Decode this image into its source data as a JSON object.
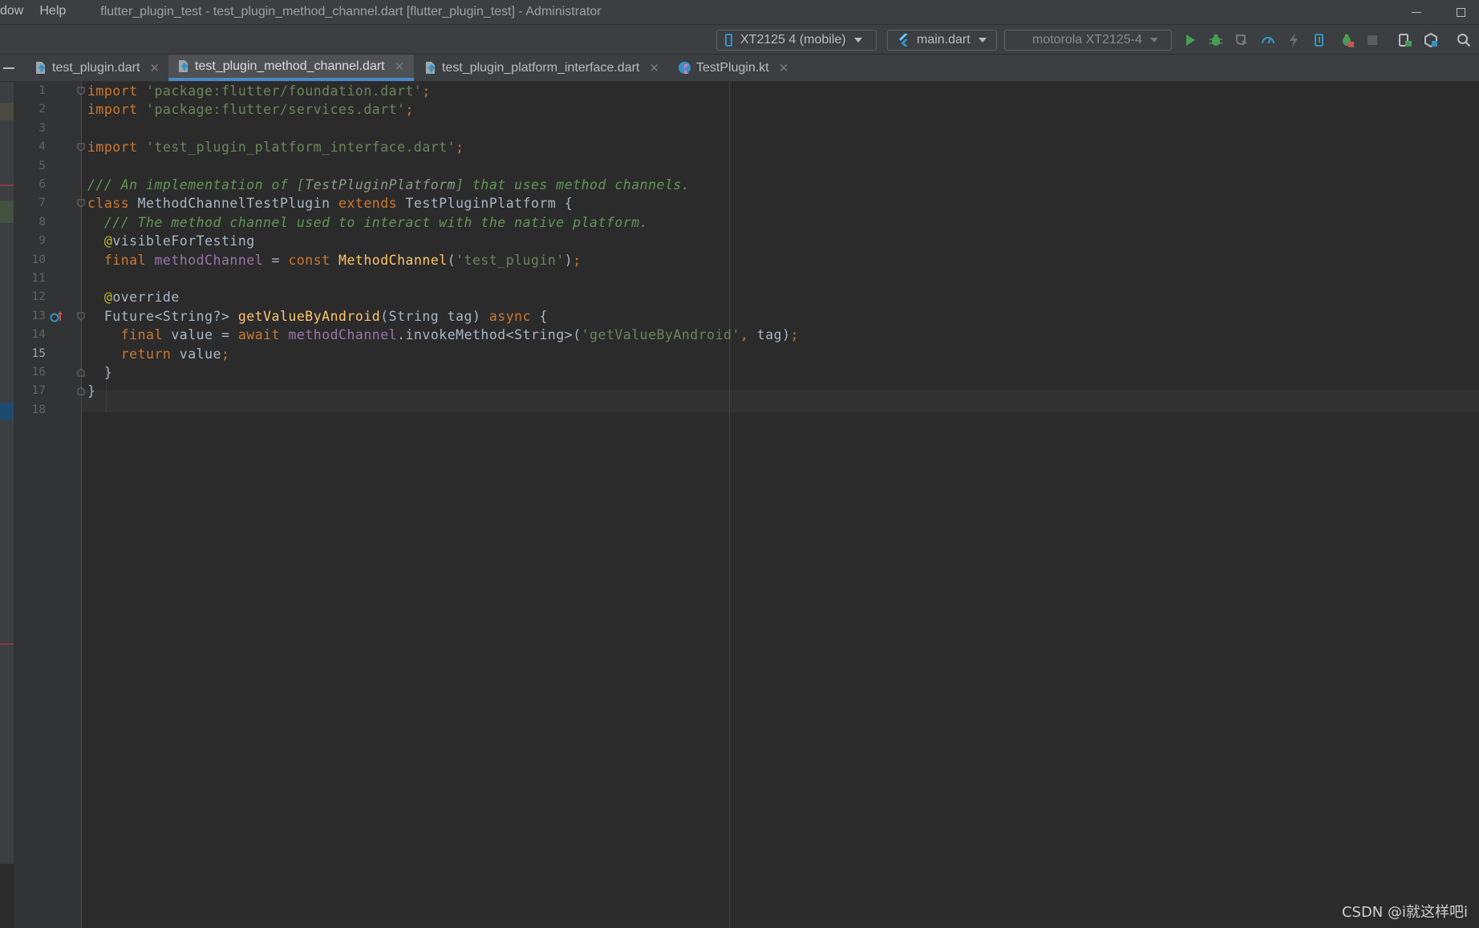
{
  "menu": {
    "items": [
      "dow",
      "Help"
    ]
  },
  "window": {
    "title": "flutter_plugin_test - test_plugin_method_channel.dart [flutter_plugin_test] - Administrator"
  },
  "toolbar": {
    "device_selector": "XT2125 4 (mobile)",
    "run_config": "main.dart",
    "target_device": "motorola XT2125-4"
  },
  "tabs": [
    {
      "label": "test_plugin.dart",
      "active": false
    },
    {
      "label": "test_plugin_method_channel.dart",
      "active": true
    },
    {
      "label": "test_plugin_platform_interface.dart",
      "active": false
    },
    {
      "label": "TestPlugin.kt",
      "active": false
    }
  ],
  "editor": {
    "current_line": 15,
    "lines": [
      {
        "n": "1",
        "tokens": [
          [
            "kw",
            "import "
          ],
          [
            "str",
            "'package:flutter/foundation.dart'"
          ],
          [
            "kw",
            ";"
          ]
        ]
      },
      {
        "n": "2",
        "tokens": [
          [
            "kw",
            "import "
          ],
          [
            "str",
            "'package:flutter/services.dart'"
          ],
          [
            "kw",
            ";"
          ]
        ]
      },
      {
        "n": "3",
        "tokens": []
      },
      {
        "n": "4",
        "tokens": [
          [
            "kw",
            "import "
          ],
          [
            "str",
            "'test_plugin_platform_interface.dart'"
          ],
          [
            "kw",
            ";"
          ]
        ]
      },
      {
        "n": "5",
        "tokens": []
      },
      {
        "n": "6",
        "tokens": [
          [
            "cmt",
            "/// An implementation of ["
          ],
          [
            "cmtref",
            "TestPluginPlatform"
          ],
          [
            "cmt",
            "] that uses method channels."
          ]
        ]
      },
      {
        "n": "7",
        "tokens": [
          [
            "kw",
            "class "
          ],
          [
            "pl",
            "MethodChannelTestPlugin "
          ],
          [
            "kw",
            "extends "
          ],
          [
            "pl",
            "TestPluginPlatform {"
          ]
        ]
      },
      {
        "n": "8",
        "tokens": [
          [
            "pl",
            "  "
          ],
          [
            "cmt",
            "/// The method channel used to interact with the native platform."
          ]
        ]
      },
      {
        "n": "9",
        "tokens": [
          [
            "pl",
            "  "
          ],
          [
            "ann",
            "@"
          ],
          [
            "pl",
            "visibleForTesting"
          ]
        ]
      },
      {
        "n": "10",
        "tokens": [
          [
            "pl",
            "  "
          ],
          [
            "kw",
            "final "
          ],
          [
            "fld",
            "methodChannel"
          ],
          [
            "pl",
            " = "
          ],
          [
            "kw",
            "const "
          ],
          [
            "fn",
            "MethodChannel"
          ],
          [
            "pl",
            "("
          ],
          [
            "str",
            "'test_plugin'"
          ],
          [
            "pl",
            ")"
          ],
          [
            "kw",
            ";"
          ]
        ]
      },
      {
        "n": "11",
        "tokens": []
      },
      {
        "n": "12",
        "tokens": [
          [
            "pl",
            "  "
          ],
          [
            "ann",
            "@"
          ],
          [
            "pl",
            "override"
          ]
        ]
      },
      {
        "n": "13",
        "tokens": [
          [
            "pl",
            "  Future<String?> "
          ],
          [
            "fn",
            "getValueByAndroid"
          ],
          [
            "pl",
            "(String tag) "
          ],
          [
            "kw",
            "async "
          ],
          [
            "pl",
            "{"
          ]
        ]
      },
      {
        "n": "14",
        "tokens": [
          [
            "pl",
            "    "
          ],
          [
            "kw",
            "final "
          ],
          [
            "pl",
            "value = "
          ],
          [
            "kw",
            "await "
          ],
          [
            "fld",
            "methodChannel"
          ],
          [
            "pl",
            ".invokeMethod<String>("
          ],
          [
            "str",
            "'getValueByAndroid'"
          ],
          [
            "kw",
            ", "
          ],
          [
            "pl",
            "tag)"
          ],
          [
            "kw",
            ";"
          ]
        ]
      },
      {
        "n": "15",
        "tokens": [
          [
            "pl",
            "    "
          ],
          [
            "kw",
            "return "
          ],
          [
            "pl",
            "value"
          ],
          [
            "kw",
            ";"
          ]
        ]
      },
      {
        "n": "16",
        "tokens": [
          [
            "pl",
            "  }"
          ]
        ]
      },
      {
        "n": "17",
        "tokens": [
          [
            "pl",
            "}"
          ]
        ]
      },
      {
        "n": "18",
        "tokens": []
      }
    ]
  },
  "watermark": "CSDN @i就这样吧i",
  "colors": {
    "background": "#2b2b2b",
    "keyword": "#cc7832",
    "string": "#6a8759",
    "comment": "#629755",
    "annotation": "#bbb529",
    "field": "#9876aa",
    "function": "#ffc66d",
    "accent": "#4a88c7"
  },
  "icons": [
    "phone-icon",
    "flutter-icon",
    "run-icon",
    "debug-icon",
    "profile-icon",
    "perf-icon",
    "hot-reload-icon",
    "attach-icon",
    "debug-attach-icon",
    "stop-icon",
    "device-manager-icon",
    "sdk-manager-icon",
    "search-icon",
    "dart-file-icon",
    "kotlin-file-icon",
    "override-icon",
    "fold-icon"
  ]
}
